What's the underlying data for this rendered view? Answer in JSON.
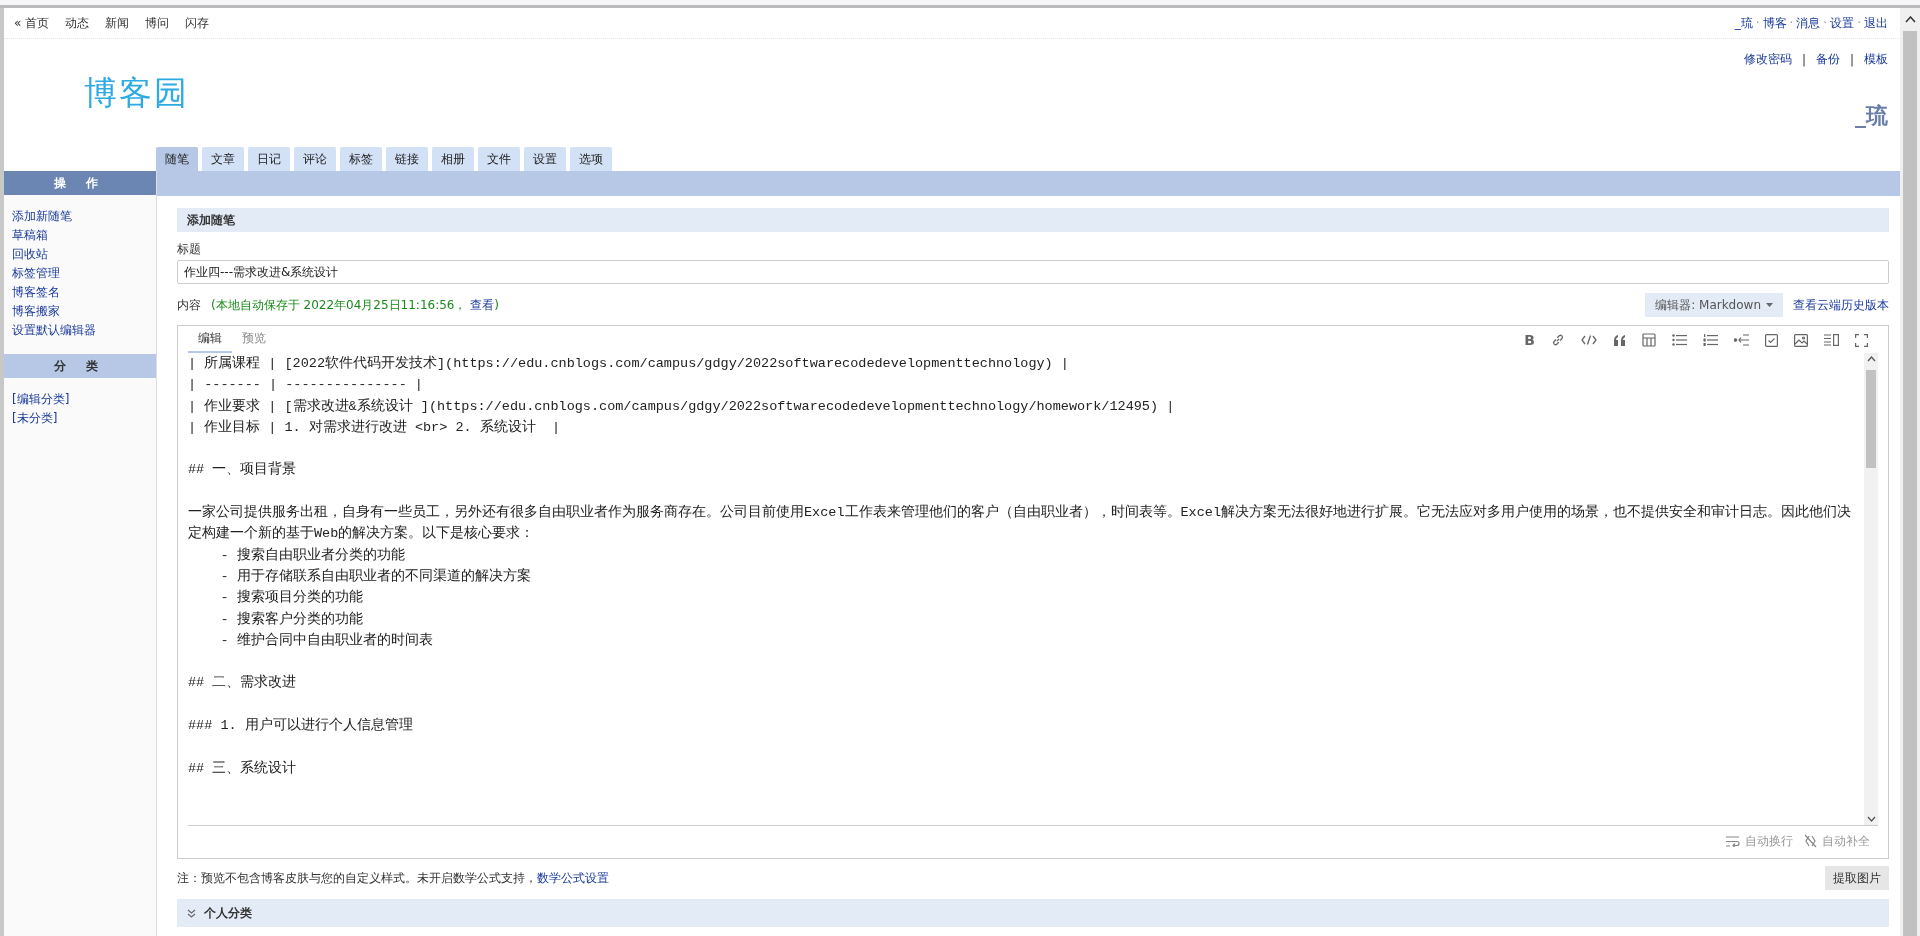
{
  "top_nav": {
    "links": [
      "« 首页",
      "动态",
      "新闻",
      "博问",
      "闪存"
    ]
  },
  "user_nav": {
    "items": [
      "_琉",
      "博客",
      "消息",
      "设置",
      "退出"
    ],
    "separator": "·"
  },
  "account_links": {
    "items": [
      "修改密码",
      "备份",
      "模板"
    ],
    "separator": "|"
  },
  "logo": "博客园",
  "blog_name": "_琉",
  "tabs": [
    {
      "label": "随笔",
      "selected": true
    },
    {
      "label": "文章",
      "selected": false
    },
    {
      "label": "日记",
      "selected": false
    },
    {
      "label": "评论",
      "selected": false
    },
    {
      "label": "标签",
      "selected": false
    },
    {
      "label": "链接",
      "selected": false
    },
    {
      "label": "相册",
      "selected": false
    },
    {
      "label": "文件",
      "selected": false
    },
    {
      "label": "设置",
      "selected": false
    },
    {
      "label": "选项",
      "selected": false
    }
  ],
  "sidebar": {
    "sections": [
      {
        "title": "操 作",
        "kind": "primary",
        "links": [
          "添加新随笔",
          "草稿箱",
          "回收站",
          "标签管理",
          "博客签名",
          "博客搬家",
          "设置默认编辑器"
        ]
      },
      {
        "title": "分 类",
        "kind": "secondary",
        "links": [
          "[编辑分类]",
          "[未分类]"
        ]
      }
    ]
  },
  "form": {
    "header": "添加随笔",
    "title_label": "标题",
    "title_value": "作业四---需求改进&系统设计",
    "content_label": "内容",
    "autosave": {
      "prefix": "(本地自动保存于 2022年04月25日11:16:56，",
      "link": "查看",
      "suffix": ")"
    },
    "editor_select": "编辑器: Markdown",
    "history_link": "查看云端历史版本"
  },
  "editor": {
    "tabs": [
      {
        "label": "编辑",
        "selected": true
      },
      {
        "label": "预览",
        "selected": false
      }
    ],
    "toolbar": [
      {
        "kind": "bold",
        "label": "B"
      },
      {
        "kind": "link"
      },
      {
        "kind": "code"
      },
      {
        "kind": "quote"
      },
      {
        "kind": "table"
      },
      {
        "kind": "bullet-list"
      },
      {
        "kind": "numbered-list"
      },
      {
        "kind": "indent"
      },
      {
        "kind": "checkbox"
      },
      {
        "kind": "image"
      },
      {
        "kind": "preview"
      },
      {
        "kind": "fullscreen"
      }
    ],
    "blocks": [
      {
        "lines": [
          "| 所属课程 | [2022软件代码开发技术](https://edu.cnblogs.com/campus/gdgy/2022softwarecodedevelopmenttechnology) |",
          "| ------- | --------------- |",
          "| 作业要求 | [需求改进&系统设计 ](https://edu.cnblogs.com/campus/gdgy/2022softwarecodedevelopmenttechnology/homework/12495) |",
          "| 作业目标 | 1. 对需求进行改进 <br> 2. 系统设计  |"
        ]
      },
      {
        "lines": [
          "## 一、项目背景"
        ]
      },
      {
        "lines": [
          "一家公司提供服务出租，自身有一些员工，另外还有很多自由职业者作为服务商存在。公司目前使用Excel工作表来管理他们的客户（自由职业者），时间表等。Excel解决方案无法很好地进行扩展。它无法应对多用户使用的场景，也不提供安全和审计日志。因此他们决定构建一个新的基于Web的解决方案。以下是核心要求：",
          "    - 搜索自由职业者分类的功能",
          "    - 用于存储联系自由职业者的不同渠道的解决方案",
          "    - 搜索项目分类的功能",
          "    - 搜索客户分类的功能",
          "    - 维护合同中自由职业者的时间表"
        ]
      },
      {
        "lines": [
          "## 二、需求改进"
        ]
      },
      {
        "lines": [
          "### 1. 用户可以进行个人信息管理"
        ]
      },
      {
        "lines": [
          "## 三、系统设计"
        ]
      }
    ],
    "footer": [
      {
        "kind": "wrap",
        "label": "自动换行"
      },
      {
        "kind": "autocomplete",
        "label": "自动补全"
      }
    ]
  },
  "note": {
    "text": "注：预览不包含博客皮肤与您的自定义样式。未开启数学公式支持，",
    "link": "数学公式设置"
  },
  "extract_button": "提取图片",
  "category_section": "个人分类"
}
